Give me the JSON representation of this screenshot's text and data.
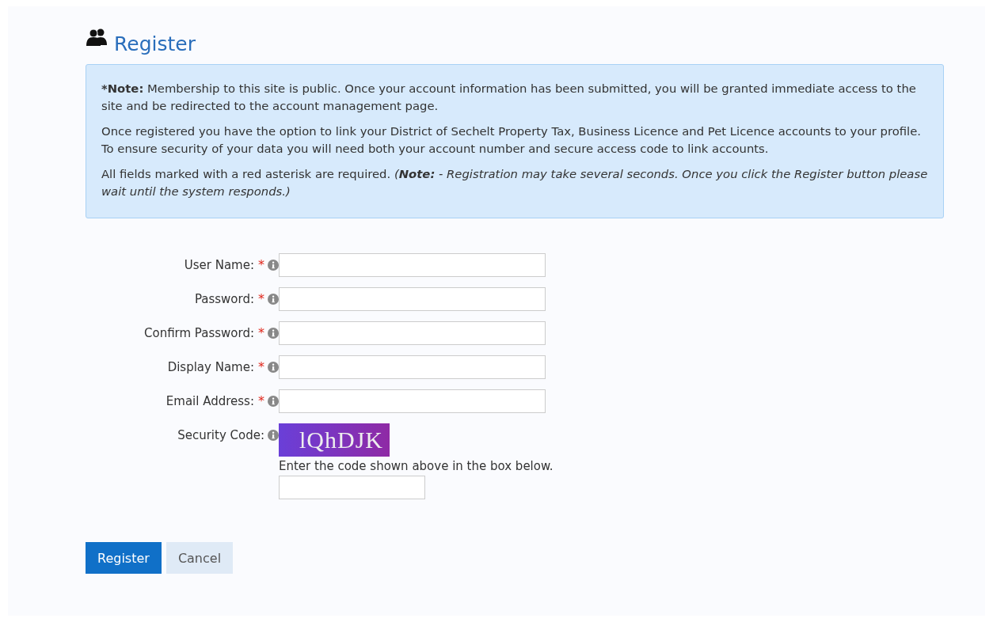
{
  "title": "Register",
  "notes": [
    {
      "lead": "*Note:",
      "text": "Membership to this site is public. Once your account information has been submitted, you will be granted immediate access to the site and be redirected to the account management page."
    },
    {
      "text": "Once registered you have the option to link your District of Sechelt Property Tax, Business Licence and Pet Licence accounts to your profile. To ensure security of your data you will need both your account number and secure access code to link accounts."
    },
    {
      "text": "All fields marked with a red asterisk are required.",
      "aside": "(**Note:** - Registration may take several seconds. Once you click the Register button please wait until the system responds.)"
    }
  ],
  "fields": [
    {
      "kind": "text",
      "label": "User Name:",
      "asterisk": "*"
    },
    {
      "kind": "text",
      "label": "Password:",
      "asterisk": "*"
    },
    {
      "kind": "text",
      "label": "Confirm Password:",
      "asterisk": "*"
    },
    {
      "kind": "text",
      "label": "Display Name:",
      "asterisk": "*"
    },
    {
      "kind": "text",
      "label": "Email Address:",
      "asterisk": "*"
    },
    {
      "kind": "captcha",
      "label": "Security Code:",
      "code": "lQhDJK",
      "hint": "Enter the code shown above in the box below."
    }
  ],
  "buttons": [
    {
      "label": "Register",
      "primary": true
    },
    {
      "label": "Cancel",
      "primary": false
    }
  ]
}
